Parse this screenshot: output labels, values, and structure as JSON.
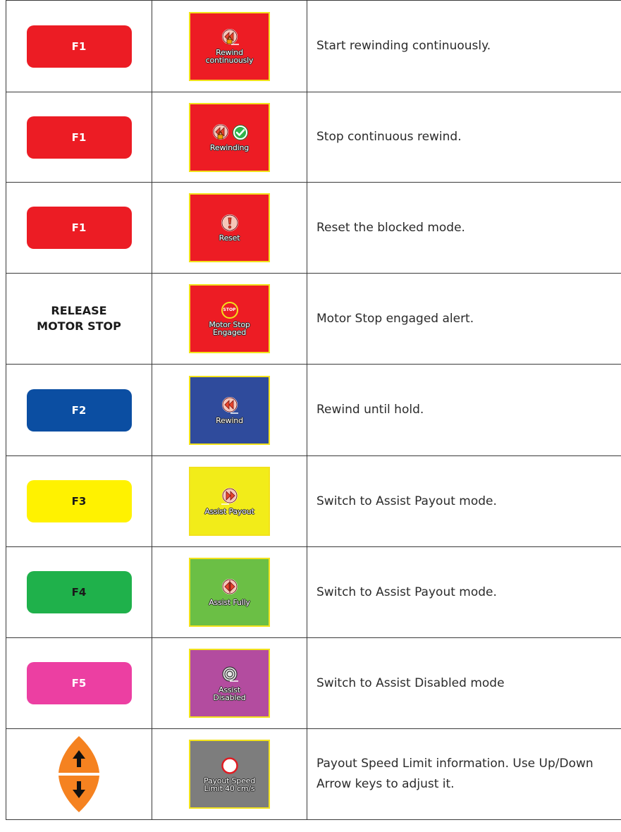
{
  "rows": [
    {
      "key": "F1",
      "key_color": "#ec1c24",
      "screen_bg": "#ed1c24",
      "screen_label": "Rewind\ncontinuously",
      "icon": "rewind-lock-icon",
      "description": "Start rewinding continuously."
    },
    {
      "key": "F1",
      "key_color": "#ec1c24",
      "screen_bg": "#ed1c24",
      "screen_label": "Rewinding",
      "icon": "rewind-lock-check-icon",
      "description": "Stop continuous rewind."
    },
    {
      "key": "F1",
      "key_color": "#ec1c24",
      "screen_bg": "#ed1c24",
      "screen_label": "Reset",
      "icon": "alert-icon",
      "description": "Reset the blocked mode."
    },
    {
      "key_line1": "RELEASE",
      "key_line2": "MOTOR STOP",
      "screen_bg": "#ed1c24",
      "screen_label": "Motor Stop\nEngaged",
      "icon": "stop-icon",
      "icon_text": "STOP",
      "description": "Motor Stop engaged alert."
    },
    {
      "key": "F2",
      "key_color": "#0b4ea2",
      "screen_bg": "#2f4b9c",
      "screen_label": "Rewind",
      "icon": "rewind-icon",
      "description": "Rewind until hold."
    },
    {
      "key": "F3",
      "key_color": "#fff200",
      "screen_bg": "#f2ec19",
      "screen_label": "Assist Payout",
      "icon": "payout-icon",
      "description": "Switch to Assist Payout mode."
    },
    {
      "key": "F4",
      "key_color": "#1fb14b",
      "screen_bg": "#6bbf45",
      "screen_label": "Assist Fully",
      "icon": "assist-fully-icon",
      "description": "Switch to Assist Payout mode."
    },
    {
      "key": "F5",
      "key_color": "#ec3fa2",
      "screen_bg": "#b34c9f",
      "screen_label": "Assist\nDisabled",
      "icon": "disabled-spiral-icon",
      "description": "Switch to Assist Disabled mode"
    },
    {
      "key_icon": "up-down-arrow-keys-icon",
      "screen_bg": "#7d7d7d",
      "screen_label": "Payout Speed\nLimit 40 cm/s",
      "icon": "circle-icon",
      "description": "Payout Speed Limit information. Use Up/Down Arrow keys to adjust it."
    }
  ]
}
